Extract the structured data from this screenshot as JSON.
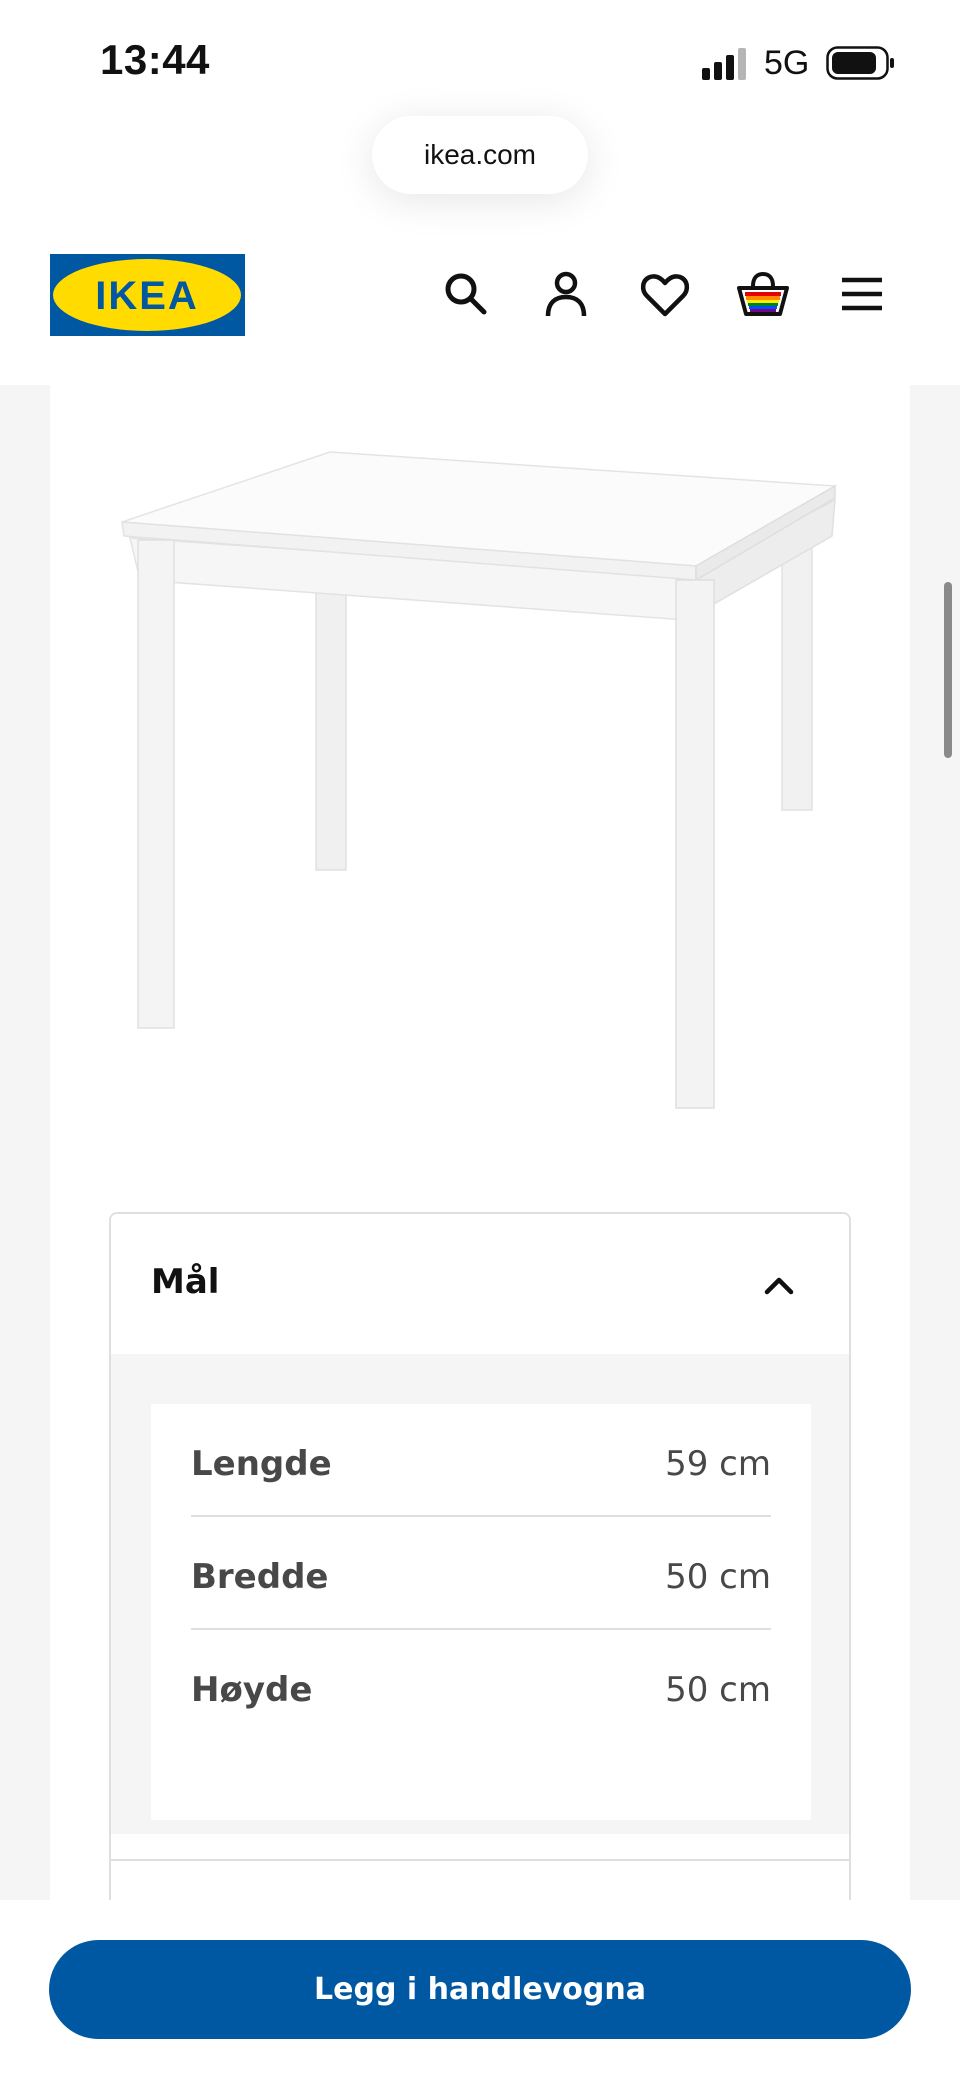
{
  "status_bar": {
    "time": "13:44",
    "network": "5G"
  },
  "browser": {
    "url": "ikea.com"
  },
  "header": {
    "logo_text": "IKEA",
    "icons": [
      "search-icon",
      "account-icon",
      "favorites-icon",
      "basket-icon",
      "menu-icon"
    ]
  },
  "accordion": {
    "title": "Mål",
    "dimensions": [
      {
        "label": "Lengde",
        "value": "59 cm"
      },
      {
        "label": "Bredde",
        "value": "50 cm"
      },
      {
        "label": "Høyde",
        "value": "50 cm"
      }
    ]
  },
  "cta": {
    "label": "Legg i handlevogna"
  },
  "colors": {
    "brand_blue": "#0058a3",
    "brand_yellow": "#ffdb00"
  }
}
